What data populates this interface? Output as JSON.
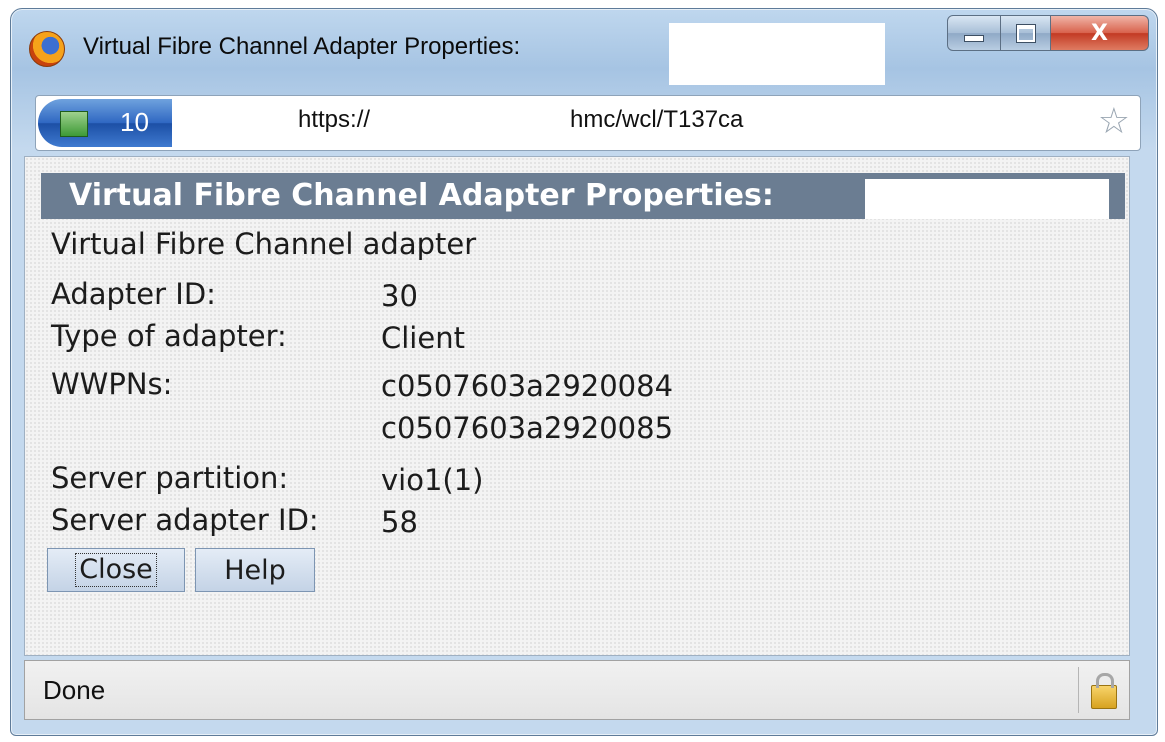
{
  "window": {
    "title": "Virtual Fibre Channel Adapter Properties:",
    "close_glyph": "X"
  },
  "address_bar": {
    "site_label": "10",
    "url_protocol": "https://",
    "url_path": "hmc/wcl/T137ca"
  },
  "panel": {
    "header": "Virtual Fibre Channel Adapter Properties:",
    "subtitle": "Virtual Fibre Channel adapter",
    "fields": {
      "adapter_id": {
        "label": "Adapter ID:",
        "value": "30"
      },
      "type": {
        "label": "Type of adapter:",
        "value": "Client"
      },
      "wwpns": {
        "label": "WWPNs:",
        "values": [
          "c0507603a2920084",
          "c0507603a2920085"
        ]
      },
      "server_partition": {
        "label": "Server partition:",
        "value": "vio1(1)"
      },
      "server_adapter_id": {
        "label": "Server adapter ID:",
        "value": "58"
      }
    },
    "buttons": {
      "close": "Close",
      "help": "Help"
    }
  },
  "status_bar": {
    "text": "Done"
  },
  "icons": {
    "app": "firefox-icon",
    "site": "site-identity-icon",
    "bookmark": "star-icon",
    "security": "lock-icon"
  }
}
